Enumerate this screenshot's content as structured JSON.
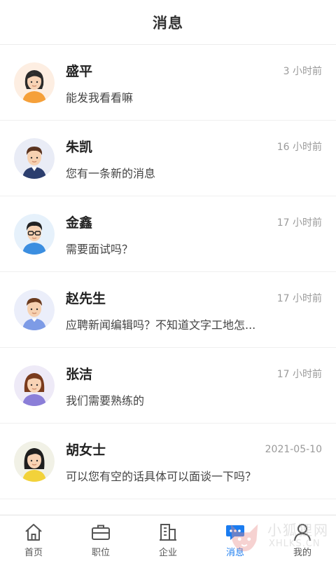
{
  "header": {
    "title": "消息"
  },
  "messages": [
    {
      "name": "盛平",
      "time": "3 小时前",
      "text": "能发我看看嘛",
      "avatar": "avatar-woman-orange"
    },
    {
      "name": "朱凯",
      "time": "16 小时前",
      "text": "您有一条新的消息",
      "avatar": "avatar-man-navy"
    },
    {
      "name": "金鑫",
      "time": "17 小时前",
      "text": "需要面试吗？",
      "avatar": "avatar-man-glasses"
    },
    {
      "name": "赵先生",
      "time": "17 小时前",
      "text": "应聘新闻编辑吗？不知道文字工地怎...",
      "avatar": "avatar-man-shirt"
    },
    {
      "name": "张洁",
      "time": "17 小时前",
      "text": "我们需要熟练的",
      "avatar": "avatar-woman-purple"
    },
    {
      "name": "胡女士",
      "time": "2021-05-10",
      "text": "可以您有空的话具体可以面谈一下吗？",
      "avatar": "avatar-woman-yellow"
    }
  ],
  "tabs": [
    {
      "label": "首页",
      "icon": "home-icon",
      "active": false
    },
    {
      "label": "职位",
      "icon": "briefcase-icon",
      "active": false
    },
    {
      "label": "企业",
      "icon": "building-icon",
      "active": false
    },
    {
      "label": "消息",
      "icon": "chat-icon",
      "active": true
    },
    {
      "label": "我的",
      "icon": "user-icon",
      "active": false
    }
  ],
  "watermark": {
    "text": "小狐狸网",
    "sub": "XHLKS.CN"
  },
  "colors": {
    "accent": "#1a7cf0",
    "text": "#222222",
    "muted": "#9a9a9a",
    "divider": "#efefef"
  }
}
